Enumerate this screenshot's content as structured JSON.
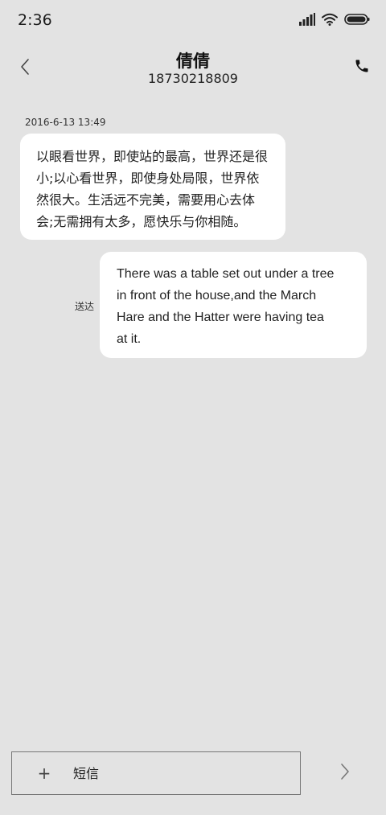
{
  "status_bar": {
    "time": "2:36",
    "icons": [
      "signal-icon",
      "wifi-icon",
      "battery-icon"
    ]
  },
  "header": {
    "contact_name": "倩倩",
    "contact_number": "18730218809",
    "back_icon": "chevron-left-icon",
    "call_icon": "phone-icon"
  },
  "conversation": {
    "timestamp": "2016-6-13 13:49",
    "messages": [
      {
        "direction": "incoming",
        "lines": [
          "以眼看世界，即使站的最高，世界还是很",
          "小;以心看世界，即使身处局限，世界依",
          "然很大。生活远不完美，需要用心去体",
          "会;无需拥有太多，愿快乐与你相随。"
        ]
      },
      {
        "direction": "outgoing",
        "status": "送达",
        "lines": [
          "There was a table set out under a tree",
          "in front of the house,and the March",
          "Hare and the Hatter were having tea",
          "at it."
        ]
      }
    ]
  },
  "composer": {
    "add_label": "+",
    "placeholder": "短信",
    "value": "",
    "send_icon": "chevron-right-icon"
  },
  "colors": {
    "background": "#e3e3e3",
    "bubble": "#ffffff",
    "text": "#1a1a1a"
  }
}
